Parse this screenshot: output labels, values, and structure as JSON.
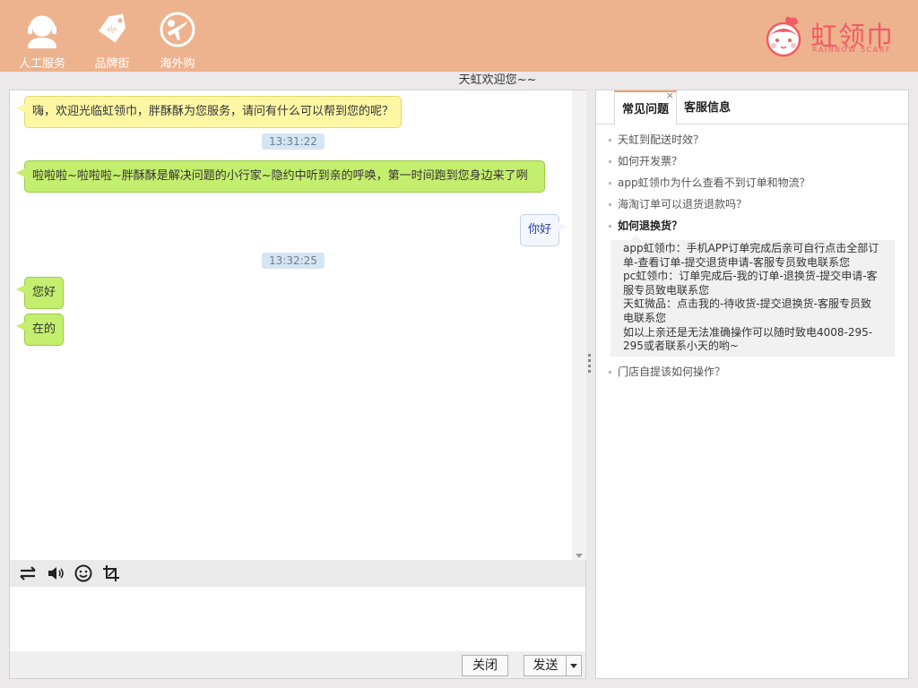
{
  "header": {
    "nav": [
      {
        "label": "人工服务",
        "icon": "customer-service-icon"
      },
      {
        "label": "品牌街",
        "icon": "price-tag-icon"
      },
      {
        "label": "海外购",
        "icon": "airplane-globe-icon"
      }
    ],
    "logo_text": "虹领巾",
    "logo_sub": "RAINBOW SCARF"
  },
  "welcome": "天虹欢迎您~~",
  "chat": {
    "messages": [
      {
        "side": "left",
        "style": "yellow",
        "text": "嗨，欢迎光临虹领巾，胖酥酥为您服务，请问有什么可以帮到您的呢？"
      },
      {
        "type": "time",
        "text": "13:31:22"
      },
      {
        "side": "left",
        "style": "green",
        "text": "啦啦啦~啦啦啦~胖酥酥是解决问题的小行家~隐约中听到亲的呼唤，第一时间跑到您身边来了咧"
      },
      {
        "side": "right",
        "style": "user",
        "text": "你好"
      },
      {
        "type": "time",
        "text": "13:32:25"
      },
      {
        "side": "left",
        "style": "green",
        "text": "您好"
      },
      {
        "side": "left",
        "style": "green",
        "text": "在的"
      }
    ],
    "toolbar": [
      "transfer-icon",
      "volume-icon",
      "emoji-icon",
      "crop-icon"
    ],
    "input_value": "",
    "close_label": "关闭",
    "send_label": "发送"
  },
  "side": {
    "tabs": [
      "常见问题",
      "客服信息"
    ],
    "active_tab": "常见问题",
    "faq": [
      {
        "q": "天虹到配送时效？"
      },
      {
        "q": "如何开发票？"
      },
      {
        "q": "app虹领巾为什么查看不到订单和物流？"
      },
      {
        "q": "海淘订单可以退货退款吗？"
      },
      {
        "q": "如何退换货？",
        "open": true,
        "answer": [
          "app虹领巾：手机APP订单完成后亲可自行点击全部订",
          "单-查看订单-提交退货申请-客服专员致电联系您",
          "pc虹领巾：订单完成后-我的订单-退换货-提交申请-客",
          "服专员致电联系您",
          "天虹微品：点击我的-待收货-提交退换货-客服专员致",
          "电联系您",
          "如以上亲还是无法准确操作可以随时致电4008-295-",
          "295或者联系小天的哟~"
        ]
      },
      {
        "q": "门店自提该如何操作？"
      }
    ]
  }
}
